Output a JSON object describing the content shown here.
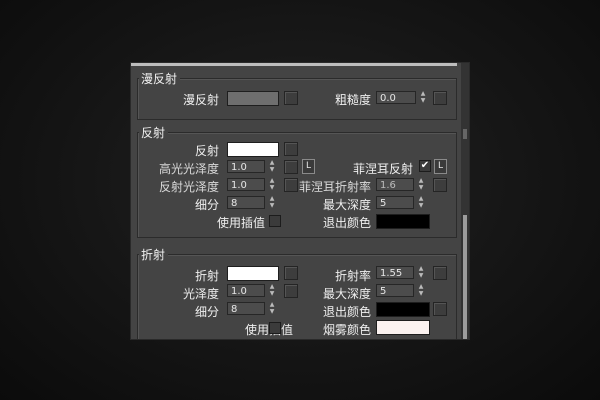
{
  "diffuse": {
    "title": "漫反射",
    "color_label": "漫反射",
    "color": "#6e6e6e",
    "roughness_label": "粗糙度",
    "roughness_value": "0.0"
  },
  "reflection": {
    "title": "反射",
    "color_label": "反射",
    "color": "#ffffff",
    "hilight_gloss_label": "高光光泽度",
    "hilight_gloss_value": "1.0",
    "hilight_lock": "L",
    "refl_gloss_label": "反射光泽度",
    "refl_gloss_value": "1.0",
    "subdivs_label": "细分",
    "subdivs_value": "8",
    "interp_label": "使用插值",
    "fresnel_label": "菲涅耳反射",
    "fresnel_checked": "✔",
    "fresnel_lock": "L",
    "fresnel_ior_label": "菲涅耳折射率",
    "fresnel_ior_value": "1.6",
    "max_depth_label": "最大深度",
    "max_depth_value": "5",
    "exit_color_label": "退出颜色",
    "exit_color": "#000000"
  },
  "refraction": {
    "title": "折射",
    "color_label": "折射",
    "color": "#ffffff",
    "gloss_label": "光泽度",
    "gloss_value": "1.0",
    "subdivs_label": "细分",
    "subdivs_value": "8",
    "interp_label": "使用插值",
    "ior_label": "折射率",
    "ior_value": "1.55",
    "max_depth_label": "最大深度",
    "max_depth_value": "5",
    "exit_color_label": "退出颜色",
    "exit_color": "#000000",
    "fog_color_label": "烟雾颜色",
    "fog_color": "#fbf2f0"
  },
  "icons": {
    "spinner_up": "▲",
    "spinner_down": "▼"
  }
}
